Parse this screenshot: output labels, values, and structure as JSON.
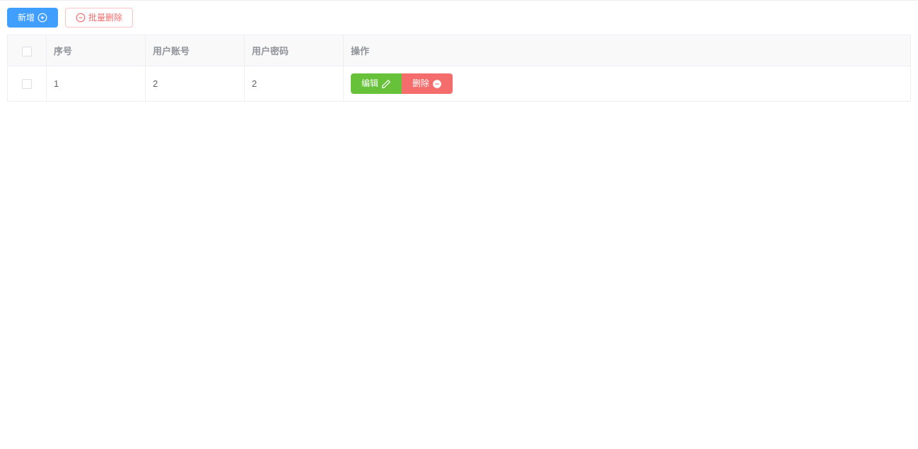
{
  "toolbar": {
    "add_label": "新增",
    "batch_delete_label": "批量删除"
  },
  "table": {
    "headers": {
      "index": "序号",
      "account": "用户账号",
      "password": "用户密码",
      "actions": "操作"
    },
    "rows": [
      {
        "index": "1",
        "account": "2",
        "password": "2"
      }
    ],
    "actions": {
      "edit_label": "编辑",
      "delete_label": "删除"
    }
  }
}
